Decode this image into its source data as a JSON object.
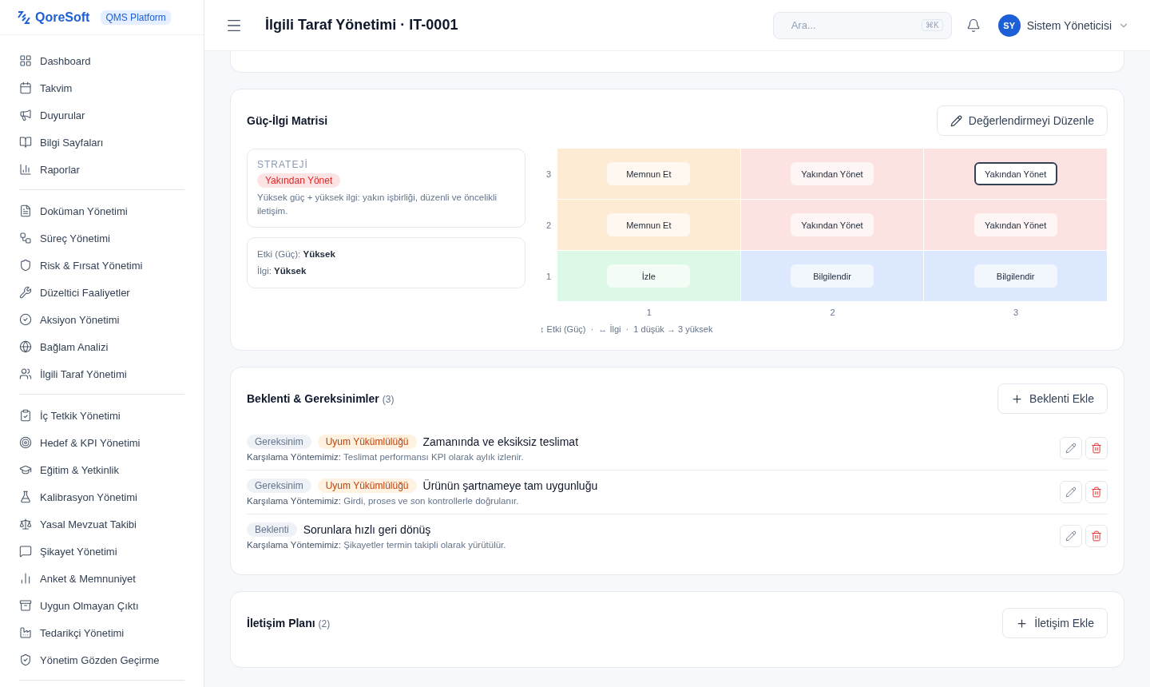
{
  "brand": {
    "name": "QoreSoft",
    "badge": "QMS Platform"
  },
  "header": {
    "title": "İlgili Taraf Yönetimi · IT-0001",
    "search": {
      "placeholder": "Ara...",
      "shortcut": "⌘K"
    },
    "user": {
      "initials": "SY",
      "name": "Sistem Yöneticisi"
    }
  },
  "sidebar": {
    "groups": [
      {
        "items": [
          {
            "label": "Dashboard"
          },
          {
            "label": "Takvim"
          },
          {
            "label": "Duyurular"
          },
          {
            "label": "Bilgi Sayfaları"
          },
          {
            "label": "Raporlar"
          }
        ]
      },
      {
        "items": [
          {
            "label": "Doküman Yönetimi"
          },
          {
            "label": "Süreç Yönetimi"
          },
          {
            "label": "Risk & Fırsat Yönetimi"
          },
          {
            "label": "Düzeltici Faaliyetler"
          },
          {
            "label": "Aksiyon Yönetimi"
          },
          {
            "label": "Bağlam Analizi"
          },
          {
            "label": "İlgili Taraf Yönetimi"
          }
        ]
      },
      {
        "items": [
          {
            "label": "İç Tetkik Yönetimi"
          },
          {
            "label": "Hedef & KPI Yönetimi"
          },
          {
            "label": "Eğitim & Yetkinlik"
          },
          {
            "label": "Kalibrasyon Yönetimi"
          },
          {
            "label": "Yasal Mevzuat Takibi"
          },
          {
            "label": "Şikayet Yönetimi"
          },
          {
            "label": "Anket & Memnuniyet"
          },
          {
            "label": "Uygun Olmayan Çıktı"
          },
          {
            "label": "Tedarikçi Yönetimi"
          },
          {
            "label": "Yönetim Gözden Geçirme"
          }
        ]
      }
    ]
  },
  "matrix": {
    "title": "Güç-İlgi Matrisi",
    "edit_button": "Değerlendirmeyi Düzenle",
    "strategy": {
      "label": "STRATEJİ",
      "badge": "Yakından Yönet",
      "description": "Yüksek güç + yüksek ilgi: yakın işbirliği, düzenli ve öncelikli iletişim."
    },
    "scores": [
      "Etki (Güç): **Yüksek**",
      "İlgi: **Yüksek**"
    ],
    "power_levels": [
      {
        "axis": "3",
        "zones": [
          {
            "label": "Memnun Et",
            "color": "#feebd4",
            "selected": false
          },
          {
            "label": "Yakından Yönet",
            "color": "#fde2e2",
            "selected": false
          },
          {
            "label": "Yakından Yönet",
            "color": "#fde2e2",
            "selected": true
          }
        ]
      },
      {
        "axis": "2",
        "zones": [
          {
            "label": "Memnun Et",
            "color": "#feebd4",
            "selected": false
          },
          {
            "label": "Yakından Yönet",
            "color": "#fde2e2",
            "selected": false
          },
          {
            "label": "Yakından Yönet",
            "color": "#fde2e2",
            "selected": false
          }
        ]
      },
      {
        "axis": "1",
        "zones": [
          {
            "label": "İzle",
            "color": "#dcf8e6",
            "selected": false
          },
          {
            "label": "Bilgilendir",
            "color": "#dbe8fd",
            "selected": false
          },
          {
            "label": "Bilgilendir",
            "color": "#dbe8fd",
            "selected": false
          }
        ]
      }
    ],
    "interest_levels": [
      "1",
      "2",
      "3"
    ],
    "legend": "↕ Etki (Güç)  ·  ↔ İlgi  ·  1 düşük → 3 yüksek"
  },
  "expectations": {
    "title": "Beklenti & Gereksinimler",
    "count": "(3)",
    "add_button": "Beklenti Ekle",
    "items": [
      {
        "tags": [
          {
            "kind": "type",
            "label": "Gereksinim"
          },
          {
            "kind": "compliance",
            "label": "Uyum Yükümlülüğü"
          }
        ],
        "title": "Zamanında ve eksiksiz teslimat",
        "method_label": "Karşılama Yöntemimiz:",
        "method": "Teslimat performansı KPI olarak aylık izlenir."
      },
      {
        "tags": [
          {
            "kind": "type",
            "label": "Gereksinim"
          },
          {
            "kind": "compliance",
            "label": "Uyum Yükümlülüğü"
          }
        ],
        "title": "Ürünün şartnameye tam uygunluğu",
        "method_label": "Karşılama Yöntemimiz:",
        "method": "Girdi, proses ve son kontrollerle doğrulanır."
      },
      {
        "tags": [
          {
            "kind": "type",
            "label": "Beklenti"
          }
        ],
        "title": "Sorunlara hızlı geri dönüş",
        "method_label": "Karşılama Yöntemimiz:",
        "method": "Şikayetler termin takipli olarak yürütülür."
      }
    ]
  },
  "communication": {
    "title": "İletişim Planı",
    "count": "(2)",
    "add_button": "İletişim Ekle"
  }
}
